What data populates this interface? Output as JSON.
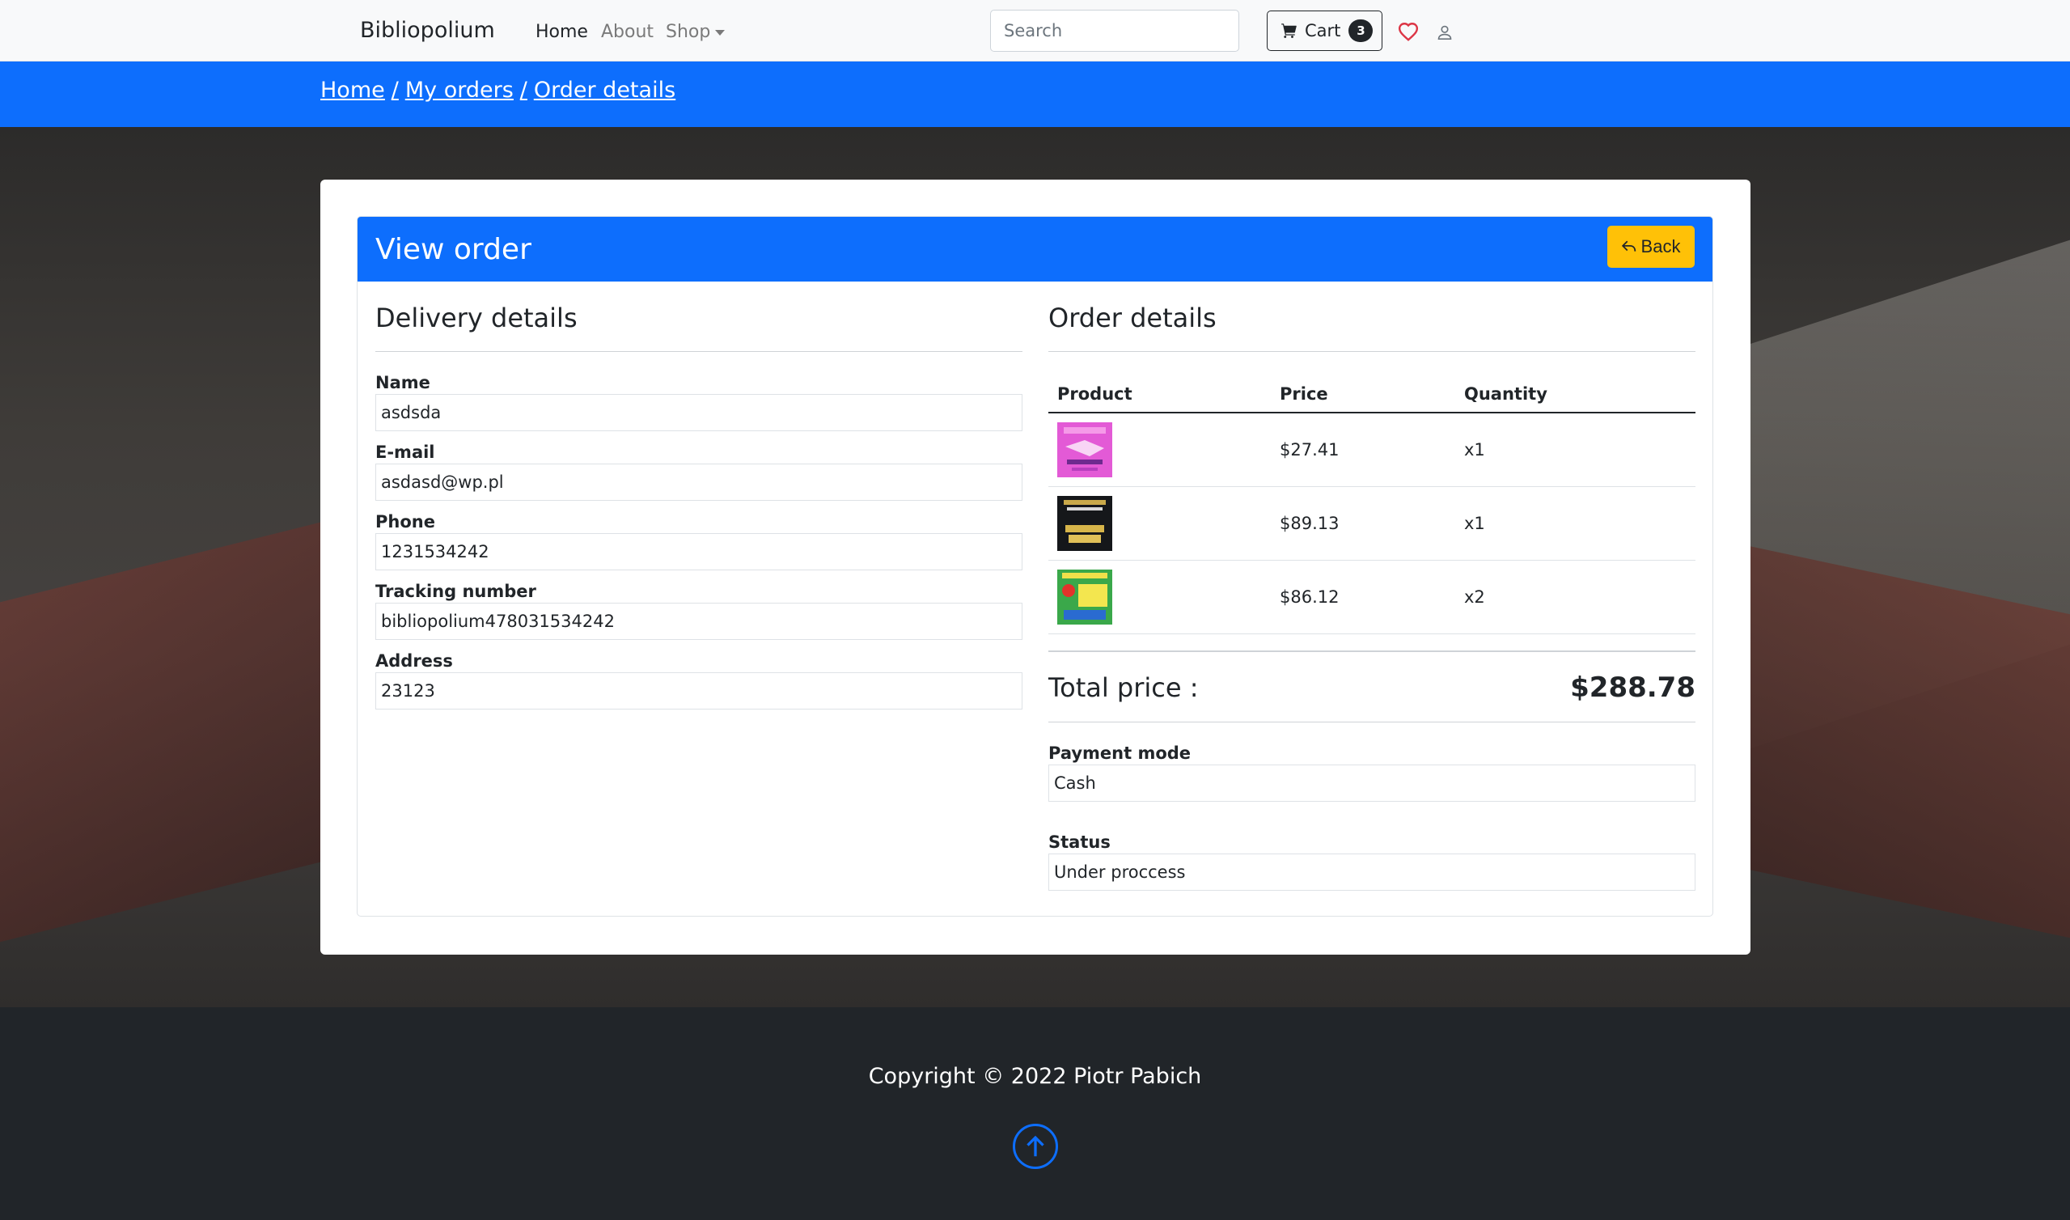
{
  "nav": {
    "brand": "Bibliopolium",
    "links": {
      "home": "Home",
      "about": "About",
      "shop": "Shop"
    },
    "search_placeholder": "Search",
    "cart_label": "Cart",
    "cart_count": "3"
  },
  "breadcrumb": {
    "home": "Home",
    "orders": "My orders",
    "details": "Order details",
    "separator": "/"
  },
  "card": {
    "title": "View order",
    "back_label": "Back",
    "delivery": {
      "title": "Delivery details",
      "fields": [
        {
          "label": "Name",
          "value": "asdsda"
        },
        {
          "label": "E-mail",
          "value": "asdasd@wp.pl"
        },
        {
          "label": "Phone",
          "value": "1231534242"
        },
        {
          "label": "Tracking number",
          "value": "bibliopolium478031534242"
        },
        {
          "label": "Address",
          "value": "23123"
        }
      ]
    },
    "order": {
      "title": "Order details",
      "columns": {
        "product": "Product",
        "price": "Price",
        "quantity": "Quantity"
      },
      "items": [
        {
          "price": "$27.41",
          "quantity": "x1",
          "cover": "pink-book-cover"
        },
        {
          "price": "$89.13",
          "quantity": "x1",
          "cover": "dark-book-cover"
        },
        {
          "price": "$86.12",
          "quantity": "x2",
          "cover": "green-book-cover"
        }
      ],
      "total_label": "Total price :",
      "total_value": "$288.78",
      "payment_label": "Payment mode",
      "payment_value": "Cash",
      "status_label": "Status",
      "status_value": "Under proccess"
    }
  },
  "footer": {
    "copyright": "Copyright © 2022 Piotr Pabich"
  },
  "colors": {
    "primary": "#0d6efd",
    "warning": "#ffc107",
    "dark": "#212529",
    "heart": "#dc3545"
  }
}
